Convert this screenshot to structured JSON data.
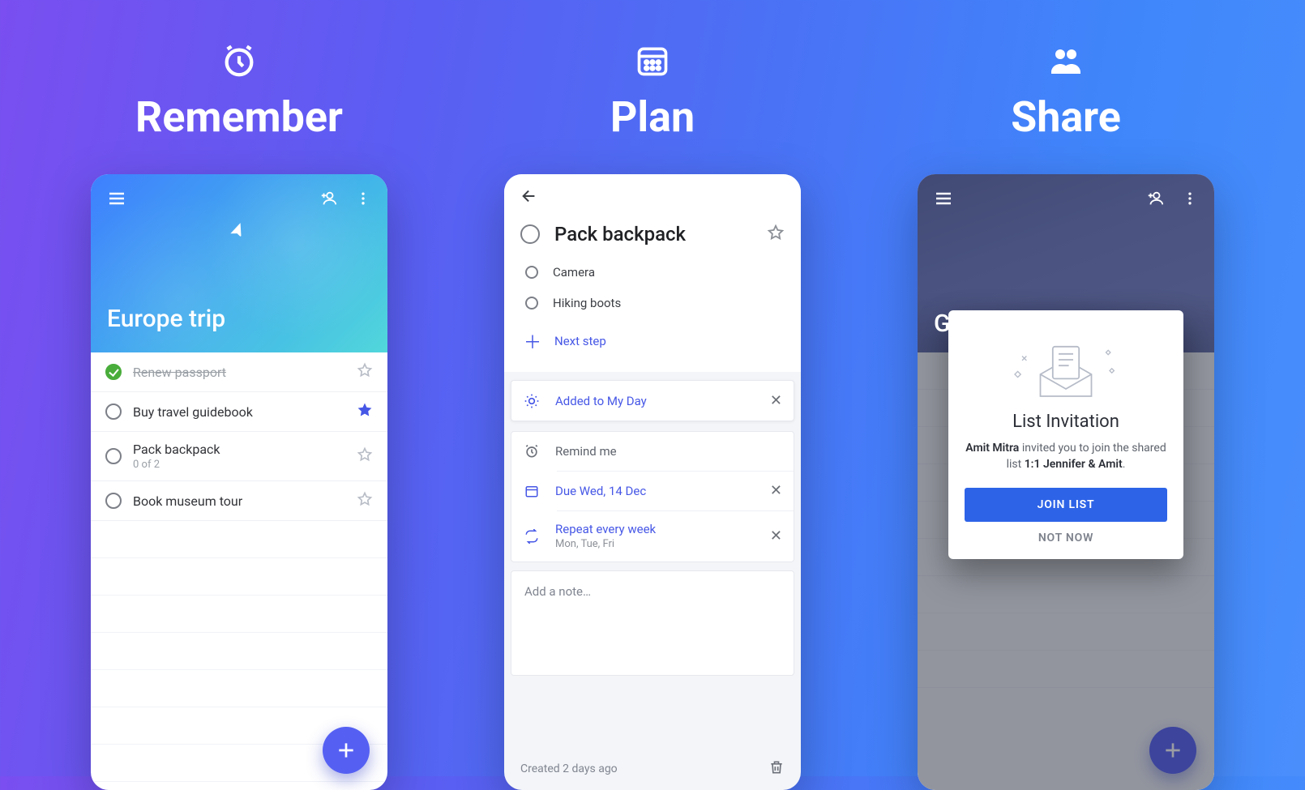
{
  "columns": [
    "Remember",
    "Plan",
    "Share"
  ],
  "panel1": {
    "list_title": "Europe trip",
    "tasks": [
      {
        "title": "Renew passport",
        "done": true,
        "starred": false,
        "sub": ""
      },
      {
        "title": "Buy travel guidebook",
        "done": false,
        "starred": true,
        "sub": ""
      },
      {
        "title": "Pack backpack",
        "done": false,
        "starred": false,
        "sub": "0 of 2"
      },
      {
        "title": "Book museum tour",
        "done": false,
        "starred": false,
        "sub": ""
      }
    ]
  },
  "panel2": {
    "task_title": "Pack backpack",
    "subtasks": [
      "Camera",
      "Hiking boots"
    ],
    "next_step": "Next step",
    "my_day": "Added to My Day",
    "remind": "Remind me",
    "due": "Due Wed, 14 Dec",
    "repeat": "Repeat every week",
    "repeat_sub": "Mon, Tue, Fri",
    "note_placeholder": "Add a note…",
    "created": "Created 2 days ago"
  },
  "panel3": {
    "list_title_peek": "G",
    "modal": {
      "title": "List Invitation",
      "inviter": "Amit Mitra",
      "text_mid": " invited you to join the shared list ",
      "list_name": "1:1 Jennifer & Amit",
      "join": "JOIN LIST",
      "not_now": "NOT NOW"
    }
  }
}
